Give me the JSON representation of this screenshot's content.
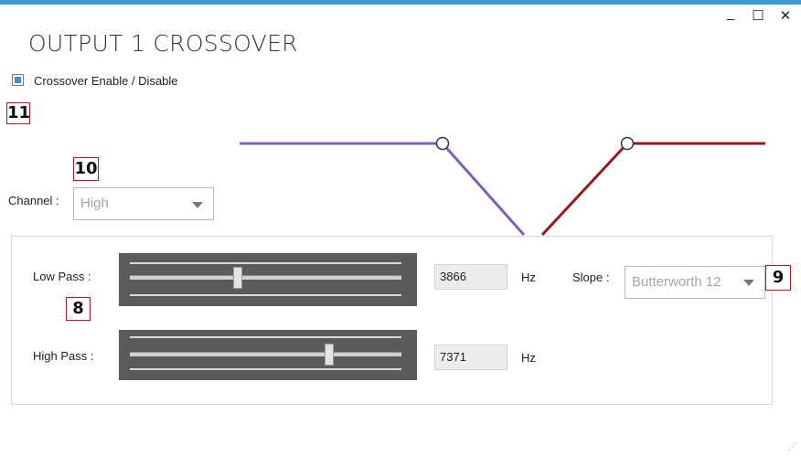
{
  "window": {
    "title": "OUTPUT 1 CROSSOVER",
    "accent_color": "#3e9bd6",
    "controls": {
      "minimize": "_",
      "maximize": "☐",
      "close": "✕"
    }
  },
  "crossover_enable": {
    "label": "Crossover Enable / Disable",
    "checked": true
  },
  "channel": {
    "label": "Channel :",
    "value": "High"
  },
  "low_pass": {
    "label": "Low Pass :",
    "value": "3866",
    "unit": "Hz",
    "slider_position": 0.4
  },
  "high_pass": {
    "label": "High Pass :",
    "value": "7371",
    "unit": "Hz",
    "slider_position": 0.75
  },
  "slope": {
    "label": "Slope :",
    "value": "Butterworth 12"
  },
  "callouts": {
    "c8": "8",
    "c9": "9",
    "c10": "10",
    "c11": "11"
  },
  "graph": {
    "low_pass_color": "#7f5fb9",
    "high_pass_color": "#951a1c"
  },
  "icons": [
    "checkbox-checked",
    "dropdown-arrow",
    "slider-thumb",
    "resize-grip"
  ]
}
